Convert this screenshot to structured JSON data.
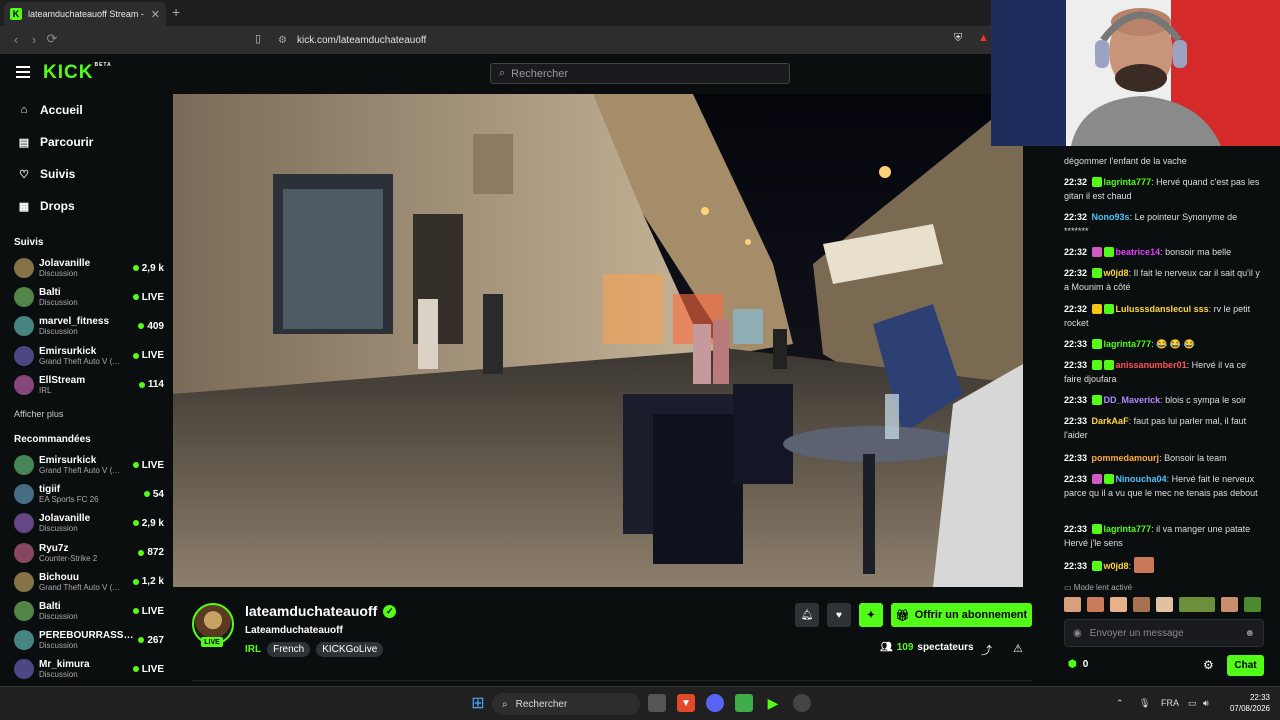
{
  "browser": {
    "tab_title": "lateamduchateauoff Stream - W",
    "tab_favicon": "K",
    "tab_close": "✕",
    "new_tab": "+",
    "url": "kick.com/lateamduchateauoff"
  },
  "kick": {
    "logo": "KICK",
    "logo_badge": "BETA",
    "search_placeholder": "Rechercher"
  },
  "sidebar": {
    "nav": [
      {
        "label": "Accueil",
        "icon": "home-icon"
      },
      {
        "label": "Parcourir",
        "icon": "browse-icon"
      },
      {
        "label": "Suivis",
        "icon": "heart-icon"
      },
      {
        "label": "Drops",
        "icon": "drops-icon"
      }
    ],
    "followed_title": "Suivis",
    "followed": [
      {
        "name": "Jolavanille",
        "category": "Discussion",
        "viewers": "2,9 k"
      },
      {
        "name": "Balti",
        "category": "Discussion",
        "viewers": "LIVE"
      },
      {
        "name": "marvel_fitness",
        "category": "Discussion",
        "viewers": "409"
      },
      {
        "name": "Emirsurkick",
        "category": "Grand Theft Auto V (…",
        "viewers": "LIVE"
      },
      {
        "name": "EllStream",
        "category": "IRL",
        "viewers": "114"
      }
    ],
    "show_more": "Afficher plus",
    "recommended_title": "Recommandées",
    "recommended": [
      {
        "name": "Emirsurkick",
        "category": "Grand Theft Auto V (…",
        "viewers": "LIVE"
      },
      {
        "name": "tigiif",
        "category": "EA Sports FC 26",
        "viewers": "54"
      },
      {
        "name": "Jolavanille",
        "category": "Discussion",
        "viewers": "2,9 k"
      },
      {
        "name": "Ryu7z",
        "category": "Counter-Strike 2",
        "viewers": "872"
      },
      {
        "name": "Bichouu",
        "category": "Grand Theft Auto V (…",
        "viewers": "1,2 k"
      },
      {
        "name": "Balti",
        "category": "Discussion",
        "viewers": "LIVE"
      },
      {
        "name": "PEREBOURRASSE69",
        "category": "Discussion",
        "viewers": "267"
      },
      {
        "name": "Mr_kimura",
        "category": "Discussion",
        "viewers": "LIVE"
      }
    ]
  },
  "stream": {
    "channel": "lateamduchateauoff",
    "live_badge": "LIVE",
    "title": "Lateamduchateauoff",
    "category": "IRL",
    "tags": [
      "French",
      "KICKGoLive"
    ],
    "subscribe_label": "Offrir un abonnement",
    "viewers_count": "109",
    "viewers_label": "spectateurs"
  },
  "chat": {
    "messages": [
      {
        "time": "",
        "user": "",
        "color": "#53fc18",
        "text": "dégommer l'enfant de la vache",
        "badges": []
      },
      {
        "time": "22:32",
        "user": "lagrinta777",
        "color": "#53fc18",
        "text": "Hervé quand c'est pas les gitan il est chaud",
        "badges": [
          "#53fc18"
        ]
      },
      {
        "time": "22:32",
        "user": "Nono93s",
        "color": "#4fc3f7",
        "text": "Le pointeur Synonyme de *******",
        "badges": []
      },
      {
        "time": "22:32",
        "user": "beatrice14",
        "color": "#e040fb",
        "text": "bonsoir ma belle",
        "badges": [
          "#d05bc4",
          "#53fc18"
        ]
      },
      {
        "time": "22:32",
        "user": "w0jd8",
        "color": "#ffd740",
        "text": "Il fait le nerveux car il sait qu'il y a Mounim à côté",
        "badges": [
          "#53fc18"
        ]
      },
      {
        "time": "22:32",
        "user": "Lulusssdanslecul sss",
        "color": "#ffd740",
        "text": "rv le petit rocket",
        "badges": [
          "#f5c518",
          "#53fc18"
        ]
      },
      {
        "time": "22:33",
        "user": "lagrinta777",
        "color": "#53fc18",
        "text": "😂 😂 😂",
        "badges": [
          "#53fc18"
        ]
      },
      {
        "time": "22:33",
        "user": "anissanumber01",
        "color": "#ff5252",
        "text": "Hervé il va ce faire djoufara",
        "badges": [
          "#53fc18",
          "#53fc18"
        ]
      },
      {
        "time": "22:33",
        "user": "DD_Maverick",
        "color": "#b388ff",
        "text": "blois c sympa le soir",
        "badges": [
          "#53fc18"
        ]
      },
      {
        "time": "22:33",
        "user": "DarkAaF",
        "color": "#ffd740",
        "text": "faut pas lui parler mal, il faut l'aider",
        "badges": []
      },
      {
        "time": "22:33",
        "user": "pommedamourj",
        "color": "#ffab40",
        "text": "Bonsoir la team",
        "badges": []
      },
      {
        "time": "22:33",
        "user": "Ninoucha04",
        "color": "#4fc3f7",
        "text": "Hervé fait le nerveux parce qu il a vu que le mec ne tenais pas debout",
        "badges": [
          "#d05bc4",
          "#53fc18"
        ]
      },
      {
        "time": "22:33",
        "user": "lagrinta777",
        "color": "#53fc18",
        "text": "il va manger une patate Hervé j'le sens",
        "badges": [
          "#53fc18"
        ]
      },
      {
        "time": "22:33",
        "user": "w0jd8",
        "color": "#ffd740",
        "text": "",
        "badges": [
          "#53fc18"
        ]
      }
    ],
    "slow_mode": "Mode lent activé",
    "input_placeholder": "Envoyer un message",
    "points": "0",
    "send_label": "Chat"
  },
  "taskbar": {
    "search": "Rechercher",
    "lang": "FRA",
    "time": "22:33",
    "date": "07/08/2026"
  }
}
